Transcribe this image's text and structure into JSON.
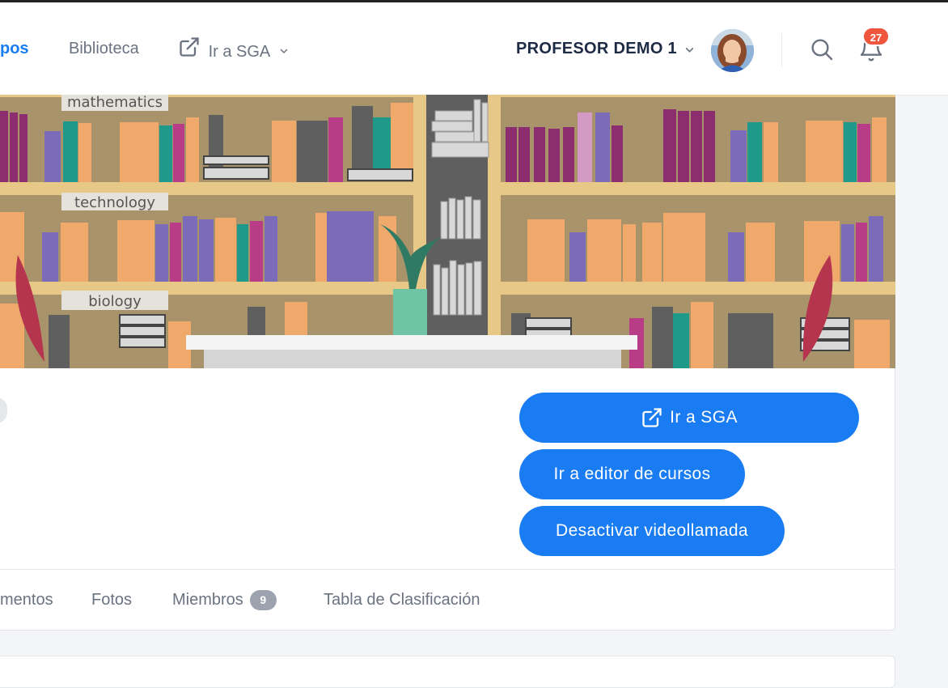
{
  "header": {
    "nav": [
      {
        "label": "pos",
        "active": true
      },
      {
        "label": "Biblioteca",
        "active": false
      },
      {
        "label": "Ir a SGA",
        "active": false
      }
    ],
    "user_name": "PROFESOR DEMO 1",
    "notification_count": "27"
  },
  "cover": {
    "shelf_labels": [
      "mathematics",
      "technology",
      "biology"
    ]
  },
  "actions": {
    "sga": "Ir a SGA",
    "editor": "Ir a editor de cursos",
    "video": "Desactivar videollamada"
  },
  "tabs": [
    {
      "label": "mentos"
    },
    {
      "label": "Fotos"
    },
    {
      "label": "Miembros",
      "count": "9"
    },
    {
      "label": "Tabla de Clasificación"
    }
  ],
  "colors": {
    "accent": "#1a7cf2",
    "badge": "#f0553d",
    "shelf_bg": "#a8936b",
    "shelf_wood": "#e8c886"
  }
}
